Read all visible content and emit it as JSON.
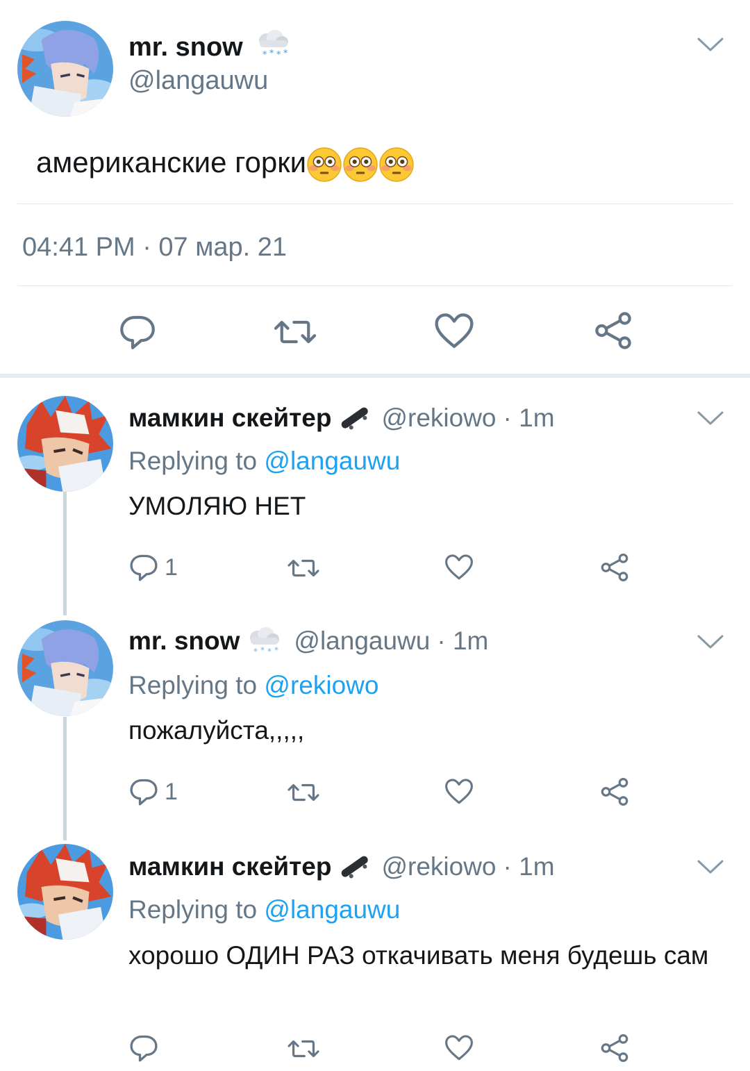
{
  "main": {
    "name": "mr. snow",
    "name_emoji": "snow-cloud-icon",
    "handle": "@langauwu",
    "text": "американские горки",
    "text_emojis": [
      "flushed-face-icon",
      "flushed-face-icon",
      "flushed-face-icon"
    ],
    "timestamp": "04:41 PM · 07 мар. 21",
    "actions": [
      "reply-icon",
      "retweet-icon",
      "like-icon",
      "share-icon"
    ]
  },
  "replies": [
    {
      "name": "мамкин скейтер",
      "name_emoji": "skateboard-icon",
      "handle": "@rekiowo",
      "time": "· 1m",
      "replying_prefix": "Replying to",
      "replying_to": "@langauwu",
      "text": "УМОЛЯЮ НЕТ",
      "reply_count": "1"
    },
    {
      "name": "mr. snow",
      "name_emoji": "snow-cloud-icon",
      "handle": "@langauwu",
      "time": "· 1m",
      "replying_prefix": "Replying to",
      "replying_to": "@rekiowo",
      "text": "пожалуйста,,,,,",
      "reply_count": "1"
    },
    {
      "name": "мамкин скейтер",
      "name_emoji": "skateboard-icon",
      "handle": "@rekiowo",
      "time": "· 1m",
      "replying_prefix": "Replying to",
      "replying_to": "@langauwu",
      "text": "хорошо ОДИН РАЗ откачивать меня будешь сам",
      "reply_count": ""
    }
  ],
  "colors": {
    "text": "#14171a",
    "secondary": "#657786",
    "link": "#1da1f2",
    "divider": "#e1e8ed",
    "thread_line": "#ccd6dd"
  }
}
